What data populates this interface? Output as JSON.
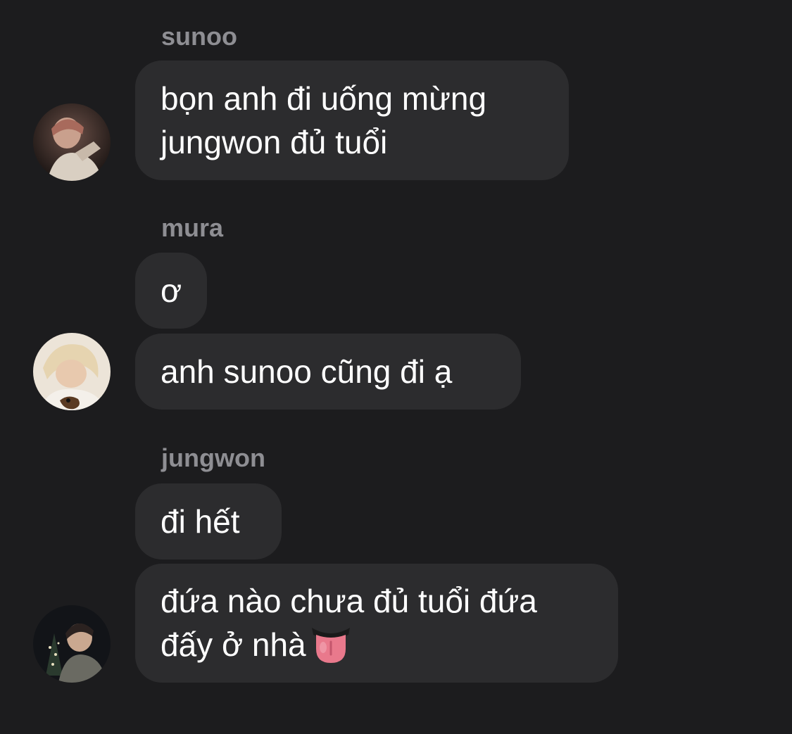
{
  "chat": {
    "groups": [
      {
        "sender": "sunoo",
        "avatar": "sunoo-avatar",
        "messages": [
          "bọn anh đi uống mừng\njungwon đủ tuổi"
        ]
      },
      {
        "sender": "mura",
        "avatar": "mura-avatar",
        "messages": [
          "ơ",
          "anh sunoo cũng đi ạ"
        ]
      },
      {
        "sender": "jungwon",
        "avatar": "jungwon-avatar",
        "messages": [
          "đi hết",
          "đứa nào chưa đủ tuổi đứa\nđấy ở nhà"
        ],
        "emoji": "tongue-emoji"
      }
    ]
  },
  "colors": {
    "background": "#1c1c1e",
    "bubble": "#2c2c2e",
    "sender_name": "#8e8e93",
    "message_text": "#ffffff"
  }
}
